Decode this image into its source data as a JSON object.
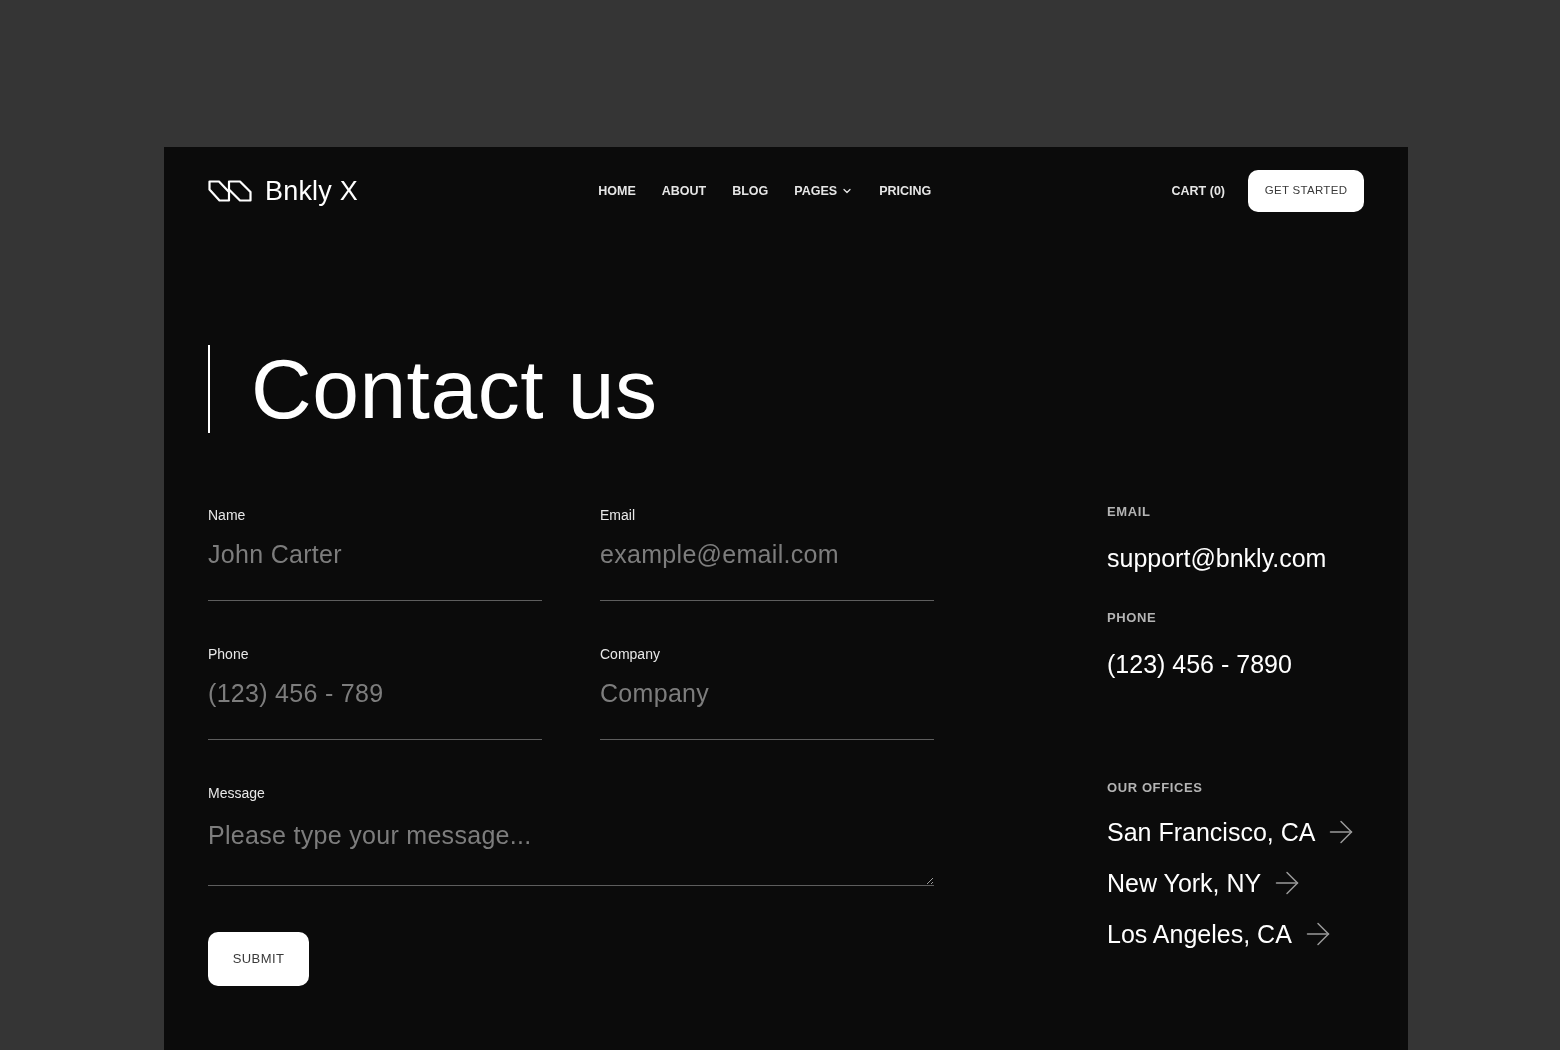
{
  "header": {
    "logo": {
      "text": "Bnkly X"
    },
    "nav": [
      {
        "label": "HOME",
        "dropdown": false
      },
      {
        "label": "ABOUT",
        "dropdown": false
      },
      {
        "label": "BLOG",
        "dropdown": false
      },
      {
        "label": "PAGES",
        "dropdown": true
      },
      {
        "label": "PRICING",
        "dropdown": false
      }
    ],
    "cart": "CART (0)",
    "cta": "GET STARTED"
  },
  "heading": "Contact us",
  "form": {
    "fields": [
      {
        "kind": "input",
        "label": "Name",
        "placeholder": "John Carter"
      },
      {
        "kind": "input",
        "label": "Email",
        "placeholder": "example@email.com"
      },
      {
        "kind": "input",
        "label": "Phone",
        "placeholder": "(123) 456 - 789"
      },
      {
        "kind": "input",
        "label": "Company",
        "placeholder": "Company"
      },
      {
        "kind": "textarea",
        "label": "Message",
        "placeholder": "Please type your message..."
      }
    ],
    "submit": "SUBMIT"
  },
  "contact": {
    "details": [
      {
        "label": "EMAIL",
        "value": "support@bnkly.com"
      },
      {
        "label": "PHONE",
        "value": "(123) 456 - 7890"
      }
    ],
    "offices": {
      "label": "OUR OFFICES",
      "items": [
        "San Francisco, CA",
        "New York, NY",
        "Los Angeles, CA"
      ]
    }
  }
}
